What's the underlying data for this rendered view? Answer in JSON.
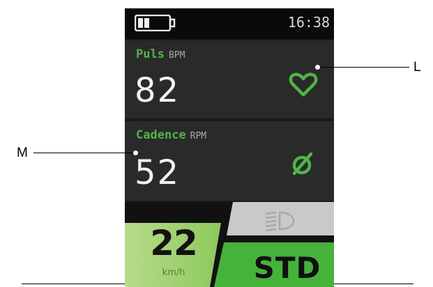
{
  "status": {
    "time": "16:38",
    "battery_level": 0.4
  },
  "puls": {
    "label": "Puls",
    "unit": "BPM",
    "value": "82",
    "icon": "heart-icon"
  },
  "cadence": {
    "label": "Cadence",
    "unit": "RPM",
    "value": "52",
    "icon": "cadence-sensor-icon"
  },
  "speed": {
    "value": "22",
    "unit": "km/h"
  },
  "mode": {
    "label": "STD",
    "light_icon": "headlight-icon"
  },
  "callouts": {
    "L": "L",
    "M": "M"
  },
  "colors": {
    "accent_green": "#4fb546",
    "speed_bg_light": "#cfe8a6",
    "speed_bg_dark": "#7fc451",
    "mode_green": "#45b23a",
    "light_tab": "#c9c9c9"
  }
}
